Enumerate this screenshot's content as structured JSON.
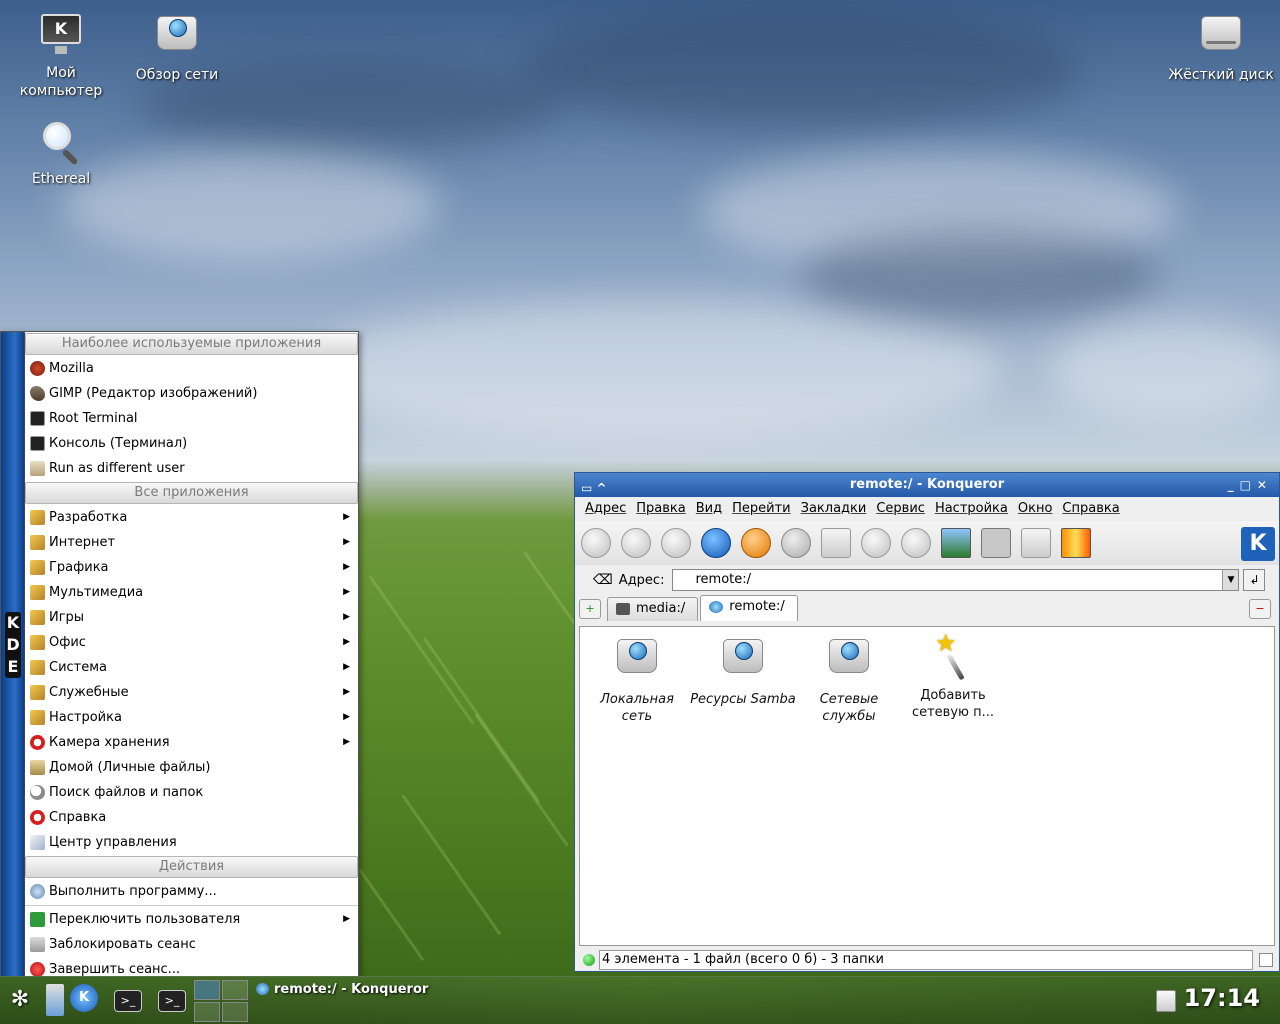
{
  "desktop": {
    "icons": [
      {
        "label": "Мой компьютер",
        "icon": "computer-icon"
      },
      {
        "label": "Обзор сети",
        "icon": "network-drive-icon"
      },
      {
        "label": "Ethereal",
        "icon": "magnifier-icon"
      },
      {
        "label": "Жёсткий диск",
        "icon": "hard-disk-icon"
      }
    ]
  },
  "kmenu": {
    "side_text": "KDE",
    "sections": {
      "most_used": "Наиболее используемые приложения",
      "all_apps": "Все приложения",
      "actions": "Действия"
    },
    "most_used": [
      {
        "label": "Mozilla",
        "icon": "mozilla-icon"
      },
      {
        "label": "GIMP (Редактор изображений)",
        "icon": "gimp-icon"
      },
      {
        "label": "Root Terminal",
        "icon": "root-terminal-icon"
      },
      {
        "label": "Консоль (Терминал)",
        "icon": "terminal-icon"
      },
      {
        "label": "Run as different user",
        "icon": "run-as-icon"
      }
    ],
    "all_apps": [
      {
        "label": "Разработка",
        "submenu": true
      },
      {
        "label": "Интернет",
        "submenu": true
      },
      {
        "label": "Графика",
        "submenu": true
      },
      {
        "label": "Мультимедиа",
        "submenu": true
      },
      {
        "label": "Игры",
        "submenu": true
      },
      {
        "label": "Офис",
        "submenu": true
      },
      {
        "label": "Система",
        "submenu": true
      },
      {
        "label": "Служебные",
        "submenu": true
      },
      {
        "label": "Настройка",
        "submenu": true
      },
      {
        "label": "Камера хранения",
        "submenu": true
      },
      {
        "label": "Домой (Личные файлы)",
        "submenu": false
      },
      {
        "label": "Поиск файлов и папок",
        "submenu": false
      },
      {
        "label": "Справка",
        "submenu": false
      },
      {
        "label": "Центр управления",
        "submenu": false
      }
    ],
    "actions": [
      {
        "label": "Выполнить программу...",
        "submenu": false
      },
      {
        "label": "Переключить пользователя",
        "submenu": true
      },
      {
        "label": "Заблокировать сеанс",
        "submenu": false
      },
      {
        "label": "Завершить сеанс...",
        "submenu": false
      }
    ],
    "arrow": "▶"
  },
  "konqueror": {
    "title": "remote:/ - Konqueror",
    "menus": [
      "Адрес",
      "Правка",
      "Вид",
      "Перейти",
      "Закладки",
      "Сервис",
      "Настройка",
      "Окно",
      "Справка"
    ],
    "location_label": "Адрес:",
    "location_value": "remote:/",
    "tabs": [
      "media:/",
      "remote:/"
    ],
    "items": [
      {
        "label": "Локальная сеть",
        "icon": "network-drive-icon"
      },
      {
        "label": "Ресурсы Samba",
        "icon": "network-drive-icon"
      },
      {
        "label": "Сетевые службы",
        "icon": "network-drive-icon"
      },
      {
        "label": "Добавить сетевую п...",
        "icon": "wizard-wand-icon"
      }
    ],
    "status": "4 элемента - 1 файл (всего 0 б) - 3 папки"
  },
  "panel": {
    "task_label": "remote:/ - Konqueror",
    "clock": "17:14"
  }
}
